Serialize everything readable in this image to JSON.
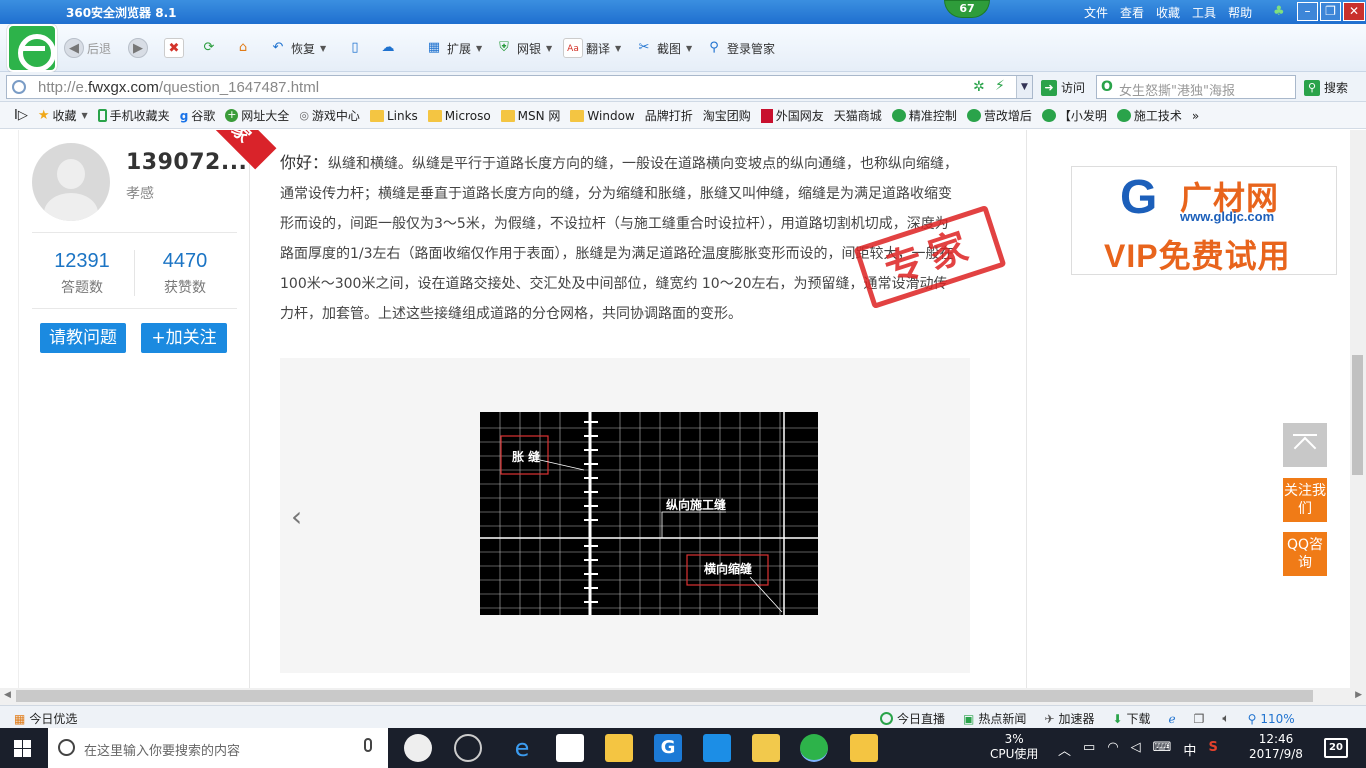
{
  "browser": {
    "title": "360安全浏览器 8.1",
    "badge_count": "67",
    "menus": [
      "文件",
      "查看",
      "收藏",
      "工具",
      "帮助"
    ],
    "toolbar": {
      "back": "后退",
      "restore": "恢复",
      "extensions": "扩展",
      "netbank": "网银",
      "translate": "翻译",
      "screenshot": "截图",
      "login_manager": "登录管家"
    },
    "address": {
      "prefix": "http://e.",
      "domain": "fwxgx.com",
      "path": "/question_1647487.html"
    },
    "visit_label": "访问",
    "search_placeholder": "女生怒撕\"港独\"海报",
    "search_label": "搜索",
    "favorites": [
      "收藏",
      "手机收藏夹",
      "谷歌",
      "网址大全",
      "游戏中心",
      "Links",
      "Microso",
      "MSN 网",
      "Window",
      "品牌打折",
      "淘宝团购",
      "外国网友",
      "天猫商城",
      "精准控制",
      "营改增后",
      "【小发明",
      "施工技术"
    ]
  },
  "profile": {
    "name": "139072...",
    "title": "孝感",
    "ribbon": "专家",
    "answers_count": "12391",
    "answers_label": "答题数",
    "likes_count": "4470",
    "likes_label": "获赞数",
    "ask_button": "请教问题",
    "follow_button": "+加关注"
  },
  "answer": {
    "greeting": "你好：",
    "text": "纵缝和横缝。纵缝是平行于道路长度方向的缝，一般设在道路横向变坡点的纵向通缝，也称纵向缩缝，通常设传力杆；横缝是垂直于道路长度方向的缝，分为缩缝和胀缝，胀缝又叫伸缝，缩缝是为满足道路收缩变形而设的，间距一般仅为3～5米，为假缝，不设拉杆（与施工缝重合时设拉杆），用道路切割机切成，深度为路面厚度的1/3左右（路面收缩仅作用于表面），胀缝是为满足道路砼温度膨胀变形而设的，间距较大，一般在100米～300米之间，设在道路交接处、交汇处及中间部位，缝宽约 10～20左右，为预留缝，通常设滑动传力杆，加套管。上述这些接缝组成道路的分仓网格，共同协调路面的变形。",
    "stamp": "专家"
  },
  "drawing": {
    "label_expansion": "胀 缝",
    "label_longitudinal": "纵向施工缝",
    "label_transverse": "横向缩缝"
  },
  "ad": {
    "name": "广材网",
    "url": "www.gldjc.com",
    "slogan": "VIP免费试用"
  },
  "side": {
    "follow": "关注我们",
    "qq": "QQ咨询"
  },
  "statusbar": {
    "today_pick": "今日优选",
    "live": "今日直播",
    "hot_news": "热点新闻",
    "accelerator": "加速器",
    "download": "下载",
    "zoom": "110%"
  },
  "taskbar": {
    "search_placeholder": "在这里输入你要搜索的内容",
    "cpu_pct": "3%",
    "cpu_label": "CPU使用",
    "ime": "中",
    "time": "12:46",
    "date": "2017/9/8",
    "notifications": "20"
  }
}
